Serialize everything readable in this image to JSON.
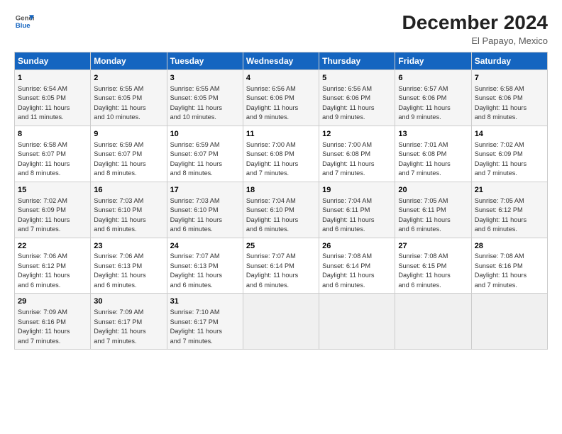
{
  "header": {
    "logo_line1": "General",
    "logo_line2": "Blue",
    "month_year": "December 2024",
    "location": "El Papayo, Mexico"
  },
  "weekdays": [
    "Sunday",
    "Monday",
    "Tuesday",
    "Wednesday",
    "Thursday",
    "Friday",
    "Saturday"
  ],
  "weeks": [
    [
      {
        "day": "1",
        "sunrise": "6:54 AM",
        "sunset": "6:05 PM",
        "daylight": "11 hours and 11 minutes."
      },
      {
        "day": "2",
        "sunrise": "6:55 AM",
        "sunset": "6:05 PM",
        "daylight": "11 hours and 10 minutes."
      },
      {
        "day": "3",
        "sunrise": "6:55 AM",
        "sunset": "6:05 PM",
        "daylight": "11 hours and 10 minutes."
      },
      {
        "day": "4",
        "sunrise": "6:56 AM",
        "sunset": "6:06 PM",
        "daylight": "11 hours and 9 minutes."
      },
      {
        "day": "5",
        "sunrise": "6:56 AM",
        "sunset": "6:06 PM",
        "daylight": "11 hours and 9 minutes."
      },
      {
        "day": "6",
        "sunrise": "6:57 AM",
        "sunset": "6:06 PM",
        "daylight": "11 hours and 9 minutes."
      },
      {
        "day": "7",
        "sunrise": "6:58 AM",
        "sunset": "6:06 PM",
        "daylight": "11 hours and 8 minutes."
      }
    ],
    [
      {
        "day": "8",
        "sunrise": "6:58 AM",
        "sunset": "6:07 PM",
        "daylight": "11 hours and 8 minutes."
      },
      {
        "day": "9",
        "sunrise": "6:59 AM",
        "sunset": "6:07 PM",
        "daylight": "11 hours and 8 minutes."
      },
      {
        "day": "10",
        "sunrise": "6:59 AM",
        "sunset": "6:07 PM",
        "daylight": "11 hours and 8 minutes."
      },
      {
        "day": "11",
        "sunrise": "7:00 AM",
        "sunset": "6:08 PM",
        "daylight": "11 hours and 7 minutes."
      },
      {
        "day": "12",
        "sunrise": "7:00 AM",
        "sunset": "6:08 PM",
        "daylight": "11 hours and 7 minutes."
      },
      {
        "day": "13",
        "sunrise": "7:01 AM",
        "sunset": "6:08 PM",
        "daylight": "11 hours and 7 minutes."
      },
      {
        "day": "14",
        "sunrise": "7:02 AM",
        "sunset": "6:09 PM",
        "daylight": "11 hours and 7 minutes."
      }
    ],
    [
      {
        "day": "15",
        "sunrise": "7:02 AM",
        "sunset": "6:09 PM",
        "daylight": "11 hours and 7 minutes."
      },
      {
        "day": "16",
        "sunrise": "7:03 AM",
        "sunset": "6:10 PM",
        "daylight": "11 hours and 6 minutes."
      },
      {
        "day": "17",
        "sunrise": "7:03 AM",
        "sunset": "6:10 PM",
        "daylight": "11 hours and 6 minutes."
      },
      {
        "day": "18",
        "sunrise": "7:04 AM",
        "sunset": "6:10 PM",
        "daylight": "11 hours and 6 minutes."
      },
      {
        "day": "19",
        "sunrise": "7:04 AM",
        "sunset": "6:11 PM",
        "daylight": "11 hours and 6 minutes."
      },
      {
        "day": "20",
        "sunrise": "7:05 AM",
        "sunset": "6:11 PM",
        "daylight": "11 hours and 6 minutes."
      },
      {
        "day": "21",
        "sunrise": "7:05 AM",
        "sunset": "6:12 PM",
        "daylight": "11 hours and 6 minutes."
      }
    ],
    [
      {
        "day": "22",
        "sunrise": "7:06 AM",
        "sunset": "6:12 PM",
        "daylight": "11 hours and 6 minutes."
      },
      {
        "day": "23",
        "sunrise": "7:06 AM",
        "sunset": "6:13 PM",
        "daylight": "11 hours and 6 minutes."
      },
      {
        "day": "24",
        "sunrise": "7:07 AM",
        "sunset": "6:13 PM",
        "daylight": "11 hours and 6 minutes."
      },
      {
        "day": "25",
        "sunrise": "7:07 AM",
        "sunset": "6:14 PM",
        "daylight": "11 hours and 6 minutes."
      },
      {
        "day": "26",
        "sunrise": "7:08 AM",
        "sunset": "6:14 PM",
        "daylight": "11 hours and 6 minutes."
      },
      {
        "day": "27",
        "sunrise": "7:08 AM",
        "sunset": "6:15 PM",
        "daylight": "11 hours and 6 minutes."
      },
      {
        "day": "28",
        "sunrise": "7:08 AM",
        "sunset": "6:16 PM",
        "daylight": "11 hours and 7 minutes."
      }
    ],
    [
      {
        "day": "29",
        "sunrise": "7:09 AM",
        "sunset": "6:16 PM",
        "daylight": "11 hours and 7 minutes."
      },
      {
        "day": "30",
        "sunrise": "7:09 AM",
        "sunset": "6:17 PM",
        "daylight": "11 hours and 7 minutes."
      },
      {
        "day": "31",
        "sunrise": "7:10 AM",
        "sunset": "6:17 PM",
        "daylight": "11 hours and 7 minutes."
      },
      null,
      null,
      null,
      null
    ]
  ]
}
